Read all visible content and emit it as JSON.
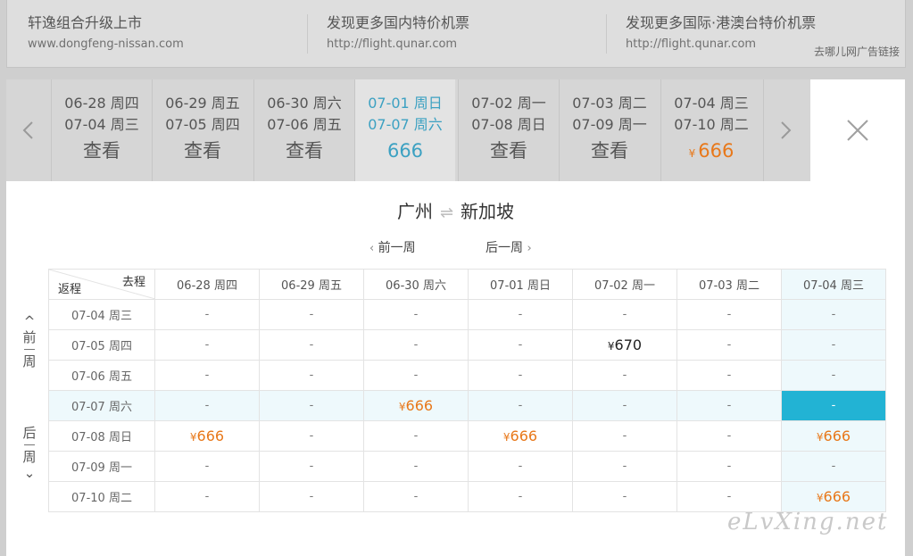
{
  "ad_banner": {
    "items": [
      {
        "title": "轩逸组合升级上市",
        "url": "www.dongfeng-nissan.com"
      },
      {
        "title": "发现更多国内特价机票",
        "url": "http://flight.qunar.com"
      },
      {
        "title": "发现更多国际·港澳台特价机票",
        "url": "http://flight.qunar.com"
      }
    ],
    "ad_link": "去哪儿网广告链接"
  },
  "date_strip": {
    "prev_icon": "chevron-left-icon",
    "next_icon": "chevron-right-icon",
    "pairs": [
      {
        "depart": "06-28 周四",
        "return": "07-04 周三",
        "value": "查看"
      },
      {
        "depart": "06-29 周五",
        "return": "07-05 周四",
        "value": "查看"
      },
      {
        "depart": "06-30 周六",
        "return": "07-06 周五",
        "value": "查看"
      },
      {
        "depart": "07-01 周日",
        "return": "07-07 周六",
        "value": "666",
        "active": true
      },
      {
        "depart": "07-02 周一",
        "return": "07-08 周日",
        "value": "查看"
      },
      {
        "depart": "07-03 周二",
        "return": "07-09 周一",
        "value": "查看"
      },
      {
        "depart": "07-04 周三",
        "return": "07-10 周二",
        "value": "666",
        "currency": "¥"
      }
    ],
    "close_icon": "close-icon"
  },
  "route": {
    "from": "广州",
    "swap_icon": "⇌",
    "to": "新加坡"
  },
  "week_nav": {
    "prev_label": "前一周",
    "next_label": "后一周",
    "prev_chevron": "‹",
    "next_chevron": "›"
  },
  "side_nav": {
    "prev": {
      "arrow": "^",
      "label_top": "前",
      "label_bottom": "周"
    },
    "next": {
      "arrow": "⌄",
      "label_top": "后",
      "label_bottom": "周"
    }
  },
  "grid": {
    "corner_depart_label": "去程",
    "corner_return_label": "返程",
    "depart_dates": [
      "06-28 周四",
      "06-29 周五",
      "06-30 周六",
      "07-01 周日",
      "07-02 周一",
      "07-03 周二",
      "07-04 周三"
    ],
    "rows": [
      {
        "return_date": "07-04 周三",
        "cells": [
          "-",
          "-",
          "-",
          "-",
          "-",
          "-",
          "-"
        ]
      },
      {
        "return_date": "07-05 周四",
        "cells": [
          "-",
          "-",
          "-",
          "-",
          "¥670",
          "-",
          "-"
        ]
      },
      {
        "return_date": "07-06 周五",
        "cells": [
          "-",
          "-",
          "-",
          "-",
          "-",
          "-",
          "-"
        ]
      },
      {
        "return_date": "07-07 周六",
        "cells": [
          "-",
          "-",
          "¥666",
          "-",
          "-",
          "-",
          "-"
        ]
      },
      {
        "return_date": "07-08 周日",
        "cells": [
          "¥666",
          "-",
          "-",
          "¥666",
          "-",
          "-",
          "¥666"
        ]
      },
      {
        "return_date": "07-09 周一",
        "cells": [
          "-",
          "-",
          "-",
          "-",
          "-",
          "-",
          "-"
        ]
      },
      {
        "return_date": "07-10 周二",
        "cells": [
          "-",
          "-",
          "-",
          "-",
          "-",
          "-",
          "¥666"
        ]
      }
    ],
    "highlight_column": 6,
    "highlight_row": 3,
    "selected_cell": [
      3,
      6
    ]
  },
  "watermark": "eLvXing.net",
  "colors": {
    "accent_blue": "#22b3d4",
    "price_orange": "#e8781a",
    "active_text": "#3ca1c2",
    "highlight_bg": "#eef9fc"
  }
}
